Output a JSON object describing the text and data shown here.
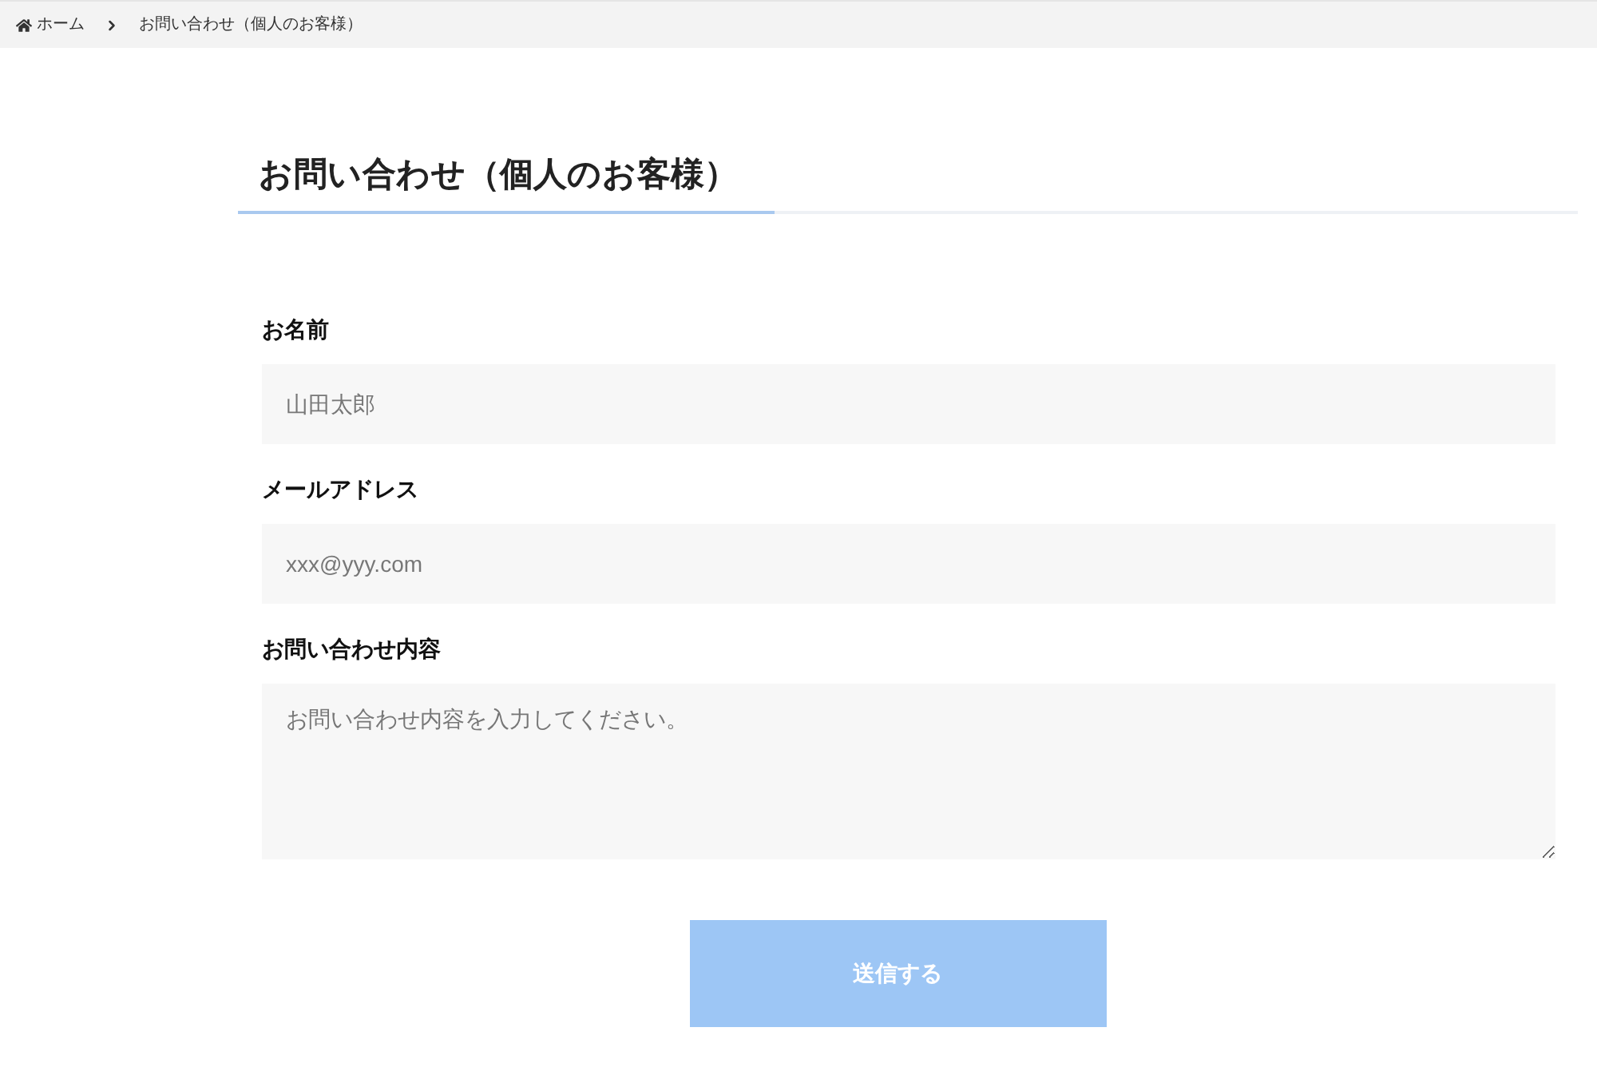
{
  "breadcrumb": [
    {
      "label": "ホーム",
      "kind": "home"
    },
    {
      "label": "お問い合わせ（個人のお客様）",
      "kind": "current"
    }
  ],
  "title": "お問い合わせ（個人のお客様）",
  "fields": [
    {
      "label": "お名前",
      "placeholder": "山田太郎",
      "kind": "input"
    },
    {
      "label": "メールアドレス",
      "placeholder": "xxx@yyy.com",
      "kind": "input"
    },
    {
      "label": "お問い合わせ内容",
      "placeholder": "お問い合わせ内容を入力してください。",
      "kind": "textarea"
    }
  ],
  "submit": {
    "label": "送信する",
    "disabled": true
  }
}
